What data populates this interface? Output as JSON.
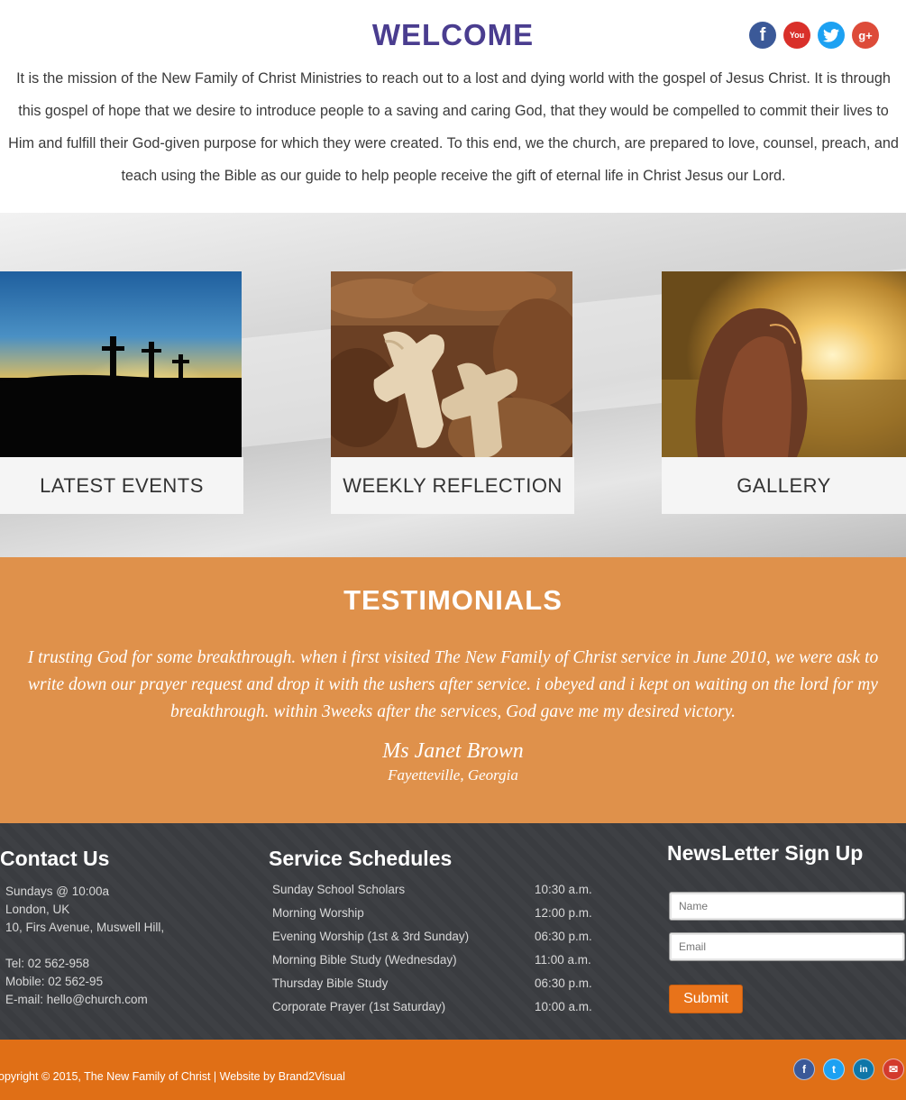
{
  "welcome": {
    "title": "WELCOME",
    "text": "It is the mission of the New Family of Christ Ministries to reach out to a lost and dying world with the gospel of Jesus Christ. It is through this gospel of hope that we desire to introduce people to a saving and caring God, that they would be compelled to commit their lives to Him and fulfill their God-given purpose for which they were created. To this end, we the church, are prepared to love, counsel, preach, and teach using the Bible as our guide to help people receive the gift of eternal life in Christ Jesus our Lord.",
    "social": [
      {
        "icon": "facebook-icon",
        "glyph": "f",
        "color": "#3b5998"
      },
      {
        "icon": "youtube-icon",
        "glyph": "You",
        "color": "#d9302a"
      },
      {
        "icon": "twitter-icon",
        "glyph": "t",
        "color": "#1da1f2"
      },
      {
        "icon": "google-plus-icon",
        "glyph": "g+",
        "color": "#dd4b39"
      }
    ]
  },
  "cards": [
    {
      "label": "LATEST EVENTS",
      "image": "crosses-sunset-photo"
    },
    {
      "label": "WEEKLY REFLECTION",
      "image": "wooden-crosses-photo"
    },
    {
      "label": "GALLERY",
      "image": "girl-in-field-photo"
    }
  ],
  "testimonials": {
    "title": "TESTIMONIALS",
    "quote": "I trusting God for some breakthrough. when i first visited The New Family of Christ service in June 2010, we were ask to write down our prayer request and drop it with the ushers after service. i obeyed and i kept on waiting on the lord for my breakthrough. within 3weeks after the services, God gave me my desired victory.",
    "name": "Ms Janet Brown",
    "location": "Fayetteville, Georgia"
  },
  "contact": {
    "title": "Contact Us",
    "line1": "Sundays @ 10:00a",
    "line2": "London, UK",
    "line3": "10, Firs Avenue, Muswell Hill,",
    "tel": "Tel: 02 562-958",
    "mobile": "Mobile: 02 562-95",
    "email": "E-mail: hello@church.com"
  },
  "schedule": {
    "title": "Service Schedules",
    "rows": [
      {
        "service": "Sunday School Scholars",
        "time": "10:30 a.m."
      },
      {
        "service": "Morning Worship",
        "time": "12:00 p.m."
      },
      {
        "service": "Evening Worship (1st & 3rd Sunday)",
        "time": "06:30 p.m."
      },
      {
        "service": "Morning Bible Study (Wednesday)",
        "time": "11:00 a.m."
      },
      {
        "service": "Thursday Bible Study",
        "time": "06:30 p.m."
      },
      {
        "service": "Corporate Prayer (1st Saturday)",
        "time": "10:00 a.m."
      }
    ]
  },
  "newsletter": {
    "title": "NewsLetter Sign Up",
    "name_placeholder": "Name",
    "email_placeholder": "Email",
    "submit_label": "Submit"
  },
  "footer": {
    "copyright": "opyright © 2015, The New Family of Christ  |  Website by Brand2Visual",
    "social": [
      {
        "icon": "facebook-icon",
        "glyph": "f"
      },
      {
        "icon": "twitter-icon",
        "glyph": "t"
      },
      {
        "icon": "linkedin-icon",
        "glyph": "in"
      },
      {
        "icon": "email-icon",
        "glyph": "✉"
      }
    ]
  },
  "colors": {
    "accent_purple": "#4a3d8f",
    "testimonial_bg": "#df914b",
    "footer_dark": "#3b3d41",
    "bottom_bar": "#e06f16"
  }
}
